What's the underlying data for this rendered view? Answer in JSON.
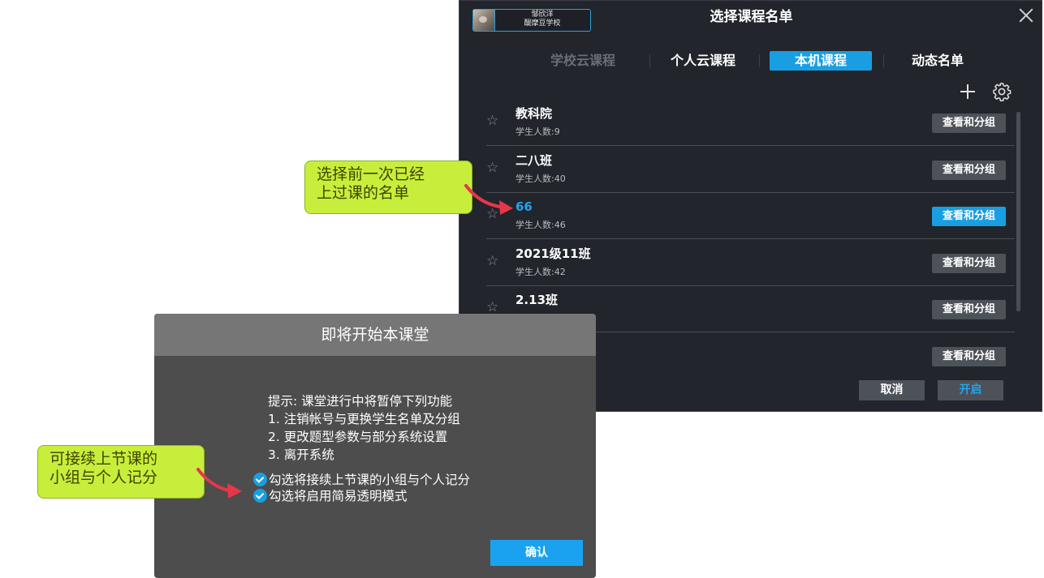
{
  "window": {
    "title": "选择课程名单",
    "user": {
      "name": "邹欣洋",
      "school": "醍摩豆学校"
    }
  },
  "tabs": [
    {
      "label": "学校云课程",
      "state": "disabled"
    },
    {
      "label": "个人云课程",
      "state": "normal"
    },
    {
      "label": "本机课程",
      "state": "active"
    },
    {
      "label": "动态名单",
      "state": "normal"
    }
  ],
  "rows": [
    {
      "name": "教科院",
      "count": "学生人数:9",
      "button": "查看和分组",
      "highlighted": false
    },
    {
      "name": "二八班",
      "count": "学生人数:40",
      "button": "查看和分组",
      "highlighted": false
    },
    {
      "name": "66",
      "count": "学生人数:46",
      "button": "查看和分组",
      "highlighted": true
    },
    {
      "name": "2021级11班",
      "count": "学生人数:42",
      "button": "查看和分组",
      "highlighted": false
    },
    {
      "name": "2.13班",
      "count": "",
      "button": "查看和分组",
      "highlighted": false
    },
    {
      "name": "",
      "count": "",
      "button": "查看和分组",
      "highlighted": false
    }
  ],
  "footer": {
    "cancel": "取消",
    "start": "开启"
  },
  "callouts": {
    "previous": {
      "line1": "选择前一次已经",
      "line2": "上过课的名单"
    },
    "continue": {
      "line1": "可接续上节课的",
      "line2": "小组与个人记分"
    }
  },
  "dialog": {
    "title": "即将开始本课堂",
    "hint": "提示: 课堂进行中将暂停下列功能",
    "items": [
      "1. 注销帐号与更换学生名单及分组",
      "2. 更改题型参数与部分系统设置",
      "3. 离开系统"
    ],
    "checks": [
      {
        "label": "勾选将接续上节课的小组与个人记分",
        "checked": true
      },
      {
        "label": "勾选将启用简易透明模式",
        "checked": true
      }
    ],
    "confirm": "确认"
  },
  "colors": {
    "accent": "#1a9ee2",
    "callout": "#c8ee3c",
    "arrow": "#e6374a",
    "window_bg": "#22252b",
    "dialog_bg": "#4d4d4d"
  }
}
